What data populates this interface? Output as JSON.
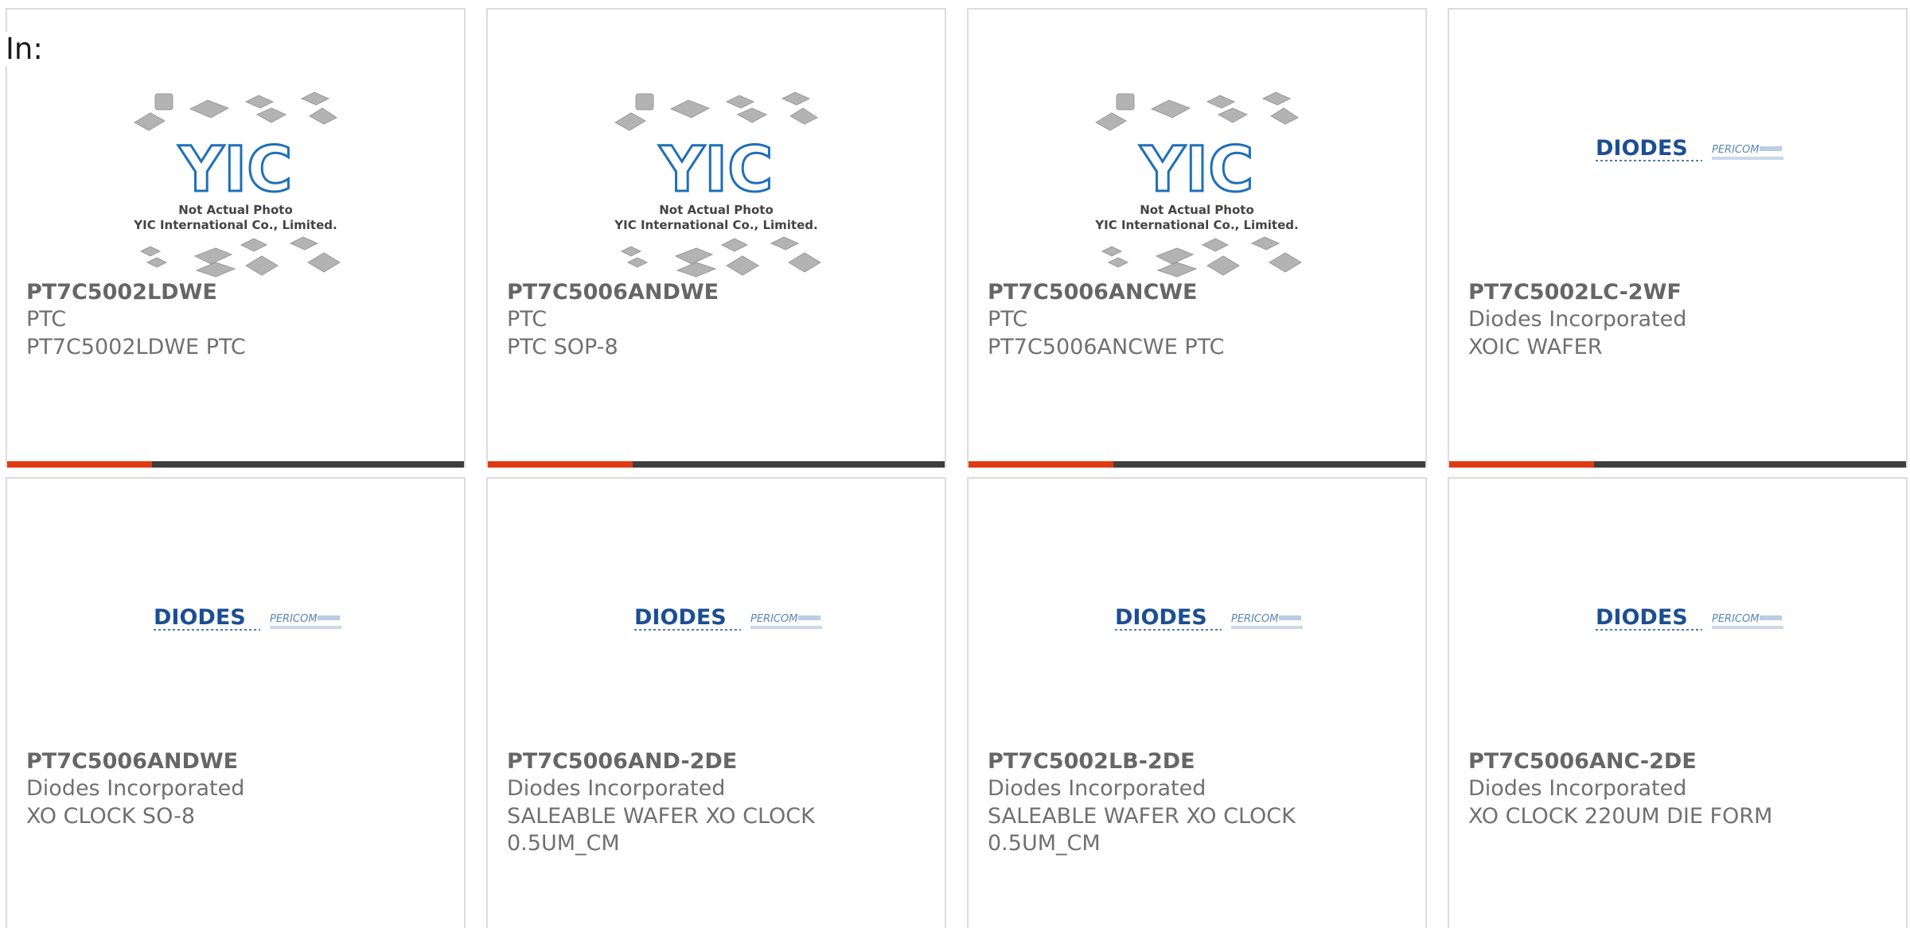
{
  "filter_label": "In:",
  "colors": {
    "accent": "#e03a12",
    "bar": "#3d3d3d",
    "border": "#dcdcdc",
    "text": "#707070"
  },
  "placeholder_photo": {
    "line1": "Not Actual Photo",
    "line2": "YIC International Co., Limited.",
    "logo": "YIC"
  },
  "diodes_photo": {
    "brand": "DIODES",
    "sub_brand": "PERICOM"
  },
  "products": [
    {
      "part": "PT7C5002LDWE",
      "maker": "PTC",
      "desc": "PT7C5002LDWE PTC",
      "photo": "yic"
    },
    {
      "part": "PT7C5006ANDWE",
      "maker": "PTC",
      "desc": "PTC SOP-8",
      "photo": "yic"
    },
    {
      "part": "PT7C5006ANCWE",
      "maker": "PTC",
      "desc": "PT7C5006ANCWE PTC",
      "photo": "yic"
    },
    {
      "part": "PT7C5002LC-2WF",
      "maker": "Diodes Incorporated",
      "desc": "XOIC WAFER",
      "photo": "diodes"
    },
    {
      "part": "PT7C5006ANDWE",
      "maker": "Diodes Incorporated",
      "desc": "XO CLOCK SO-8",
      "photo": "diodes"
    },
    {
      "part": "PT7C5006AND-2DE",
      "maker": "Diodes Incorporated",
      "desc": "SALEABLE WAFER XO CLOCK 0.5UM_CM",
      "photo": "diodes"
    },
    {
      "part": "PT7C5002LB-2DE",
      "maker": "Diodes Incorporated",
      "desc": "SALEABLE WAFER XO CLOCK 0.5UM_CM",
      "photo": "diodes"
    },
    {
      "part": "PT7C5006ANC-2DE",
      "maker": "Diodes Incorporated",
      "desc": "XO CLOCK 220UM DIE FORM",
      "photo": "diodes"
    }
  ]
}
